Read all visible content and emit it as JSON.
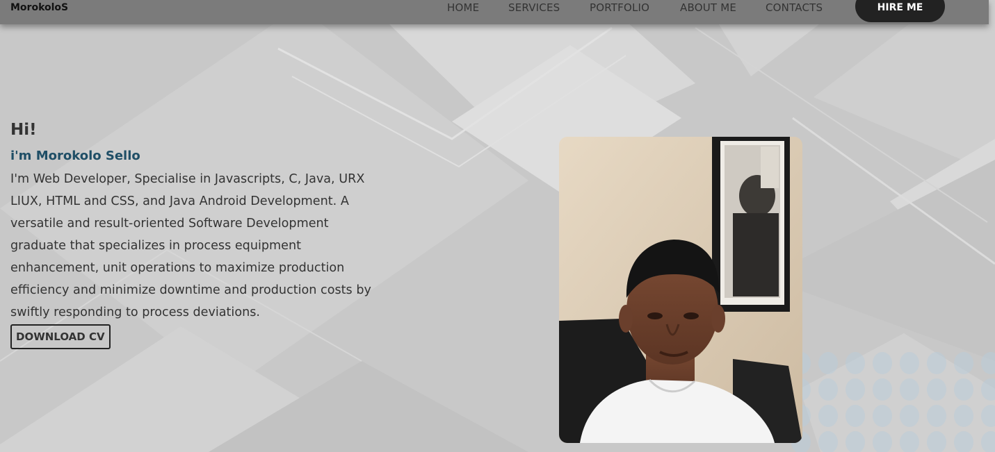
{
  "header": {
    "logo": "MorokoloS",
    "nav": [
      {
        "label": "HOME"
      },
      {
        "label": "SERVICES"
      },
      {
        "label": "PORTFOLIO"
      },
      {
        "label": "ABOUT ME"
      },
      {
        "label": "CONTACTS"
      }
    ],
    "hire_label": "HIRE ME"
  },
  "hero": {
    "greeting": "Hi!",
    "name": "i'm Morokolo Sello",
    "bio": "I'm Web Developer, Specialise in Javascripts, C, Java, URX LIUX, HTML and CSS, and Java Android Development. A versatile and result-oriented Software Development graduate that specializes in process equipment enhancement, unit operations to maximize production efficiency and minimize downtime and production costs by swiftly responding to process deviations.",
    "cv_label": "DOWNLOAD CV"
  },
  "colors": {
    "header_bg": "#7b7b7b",
    "hire_bg": "#222222",
    "name_accent": "#1f4e66",
    "page_bg": "#c9c9c9"
  }
}
